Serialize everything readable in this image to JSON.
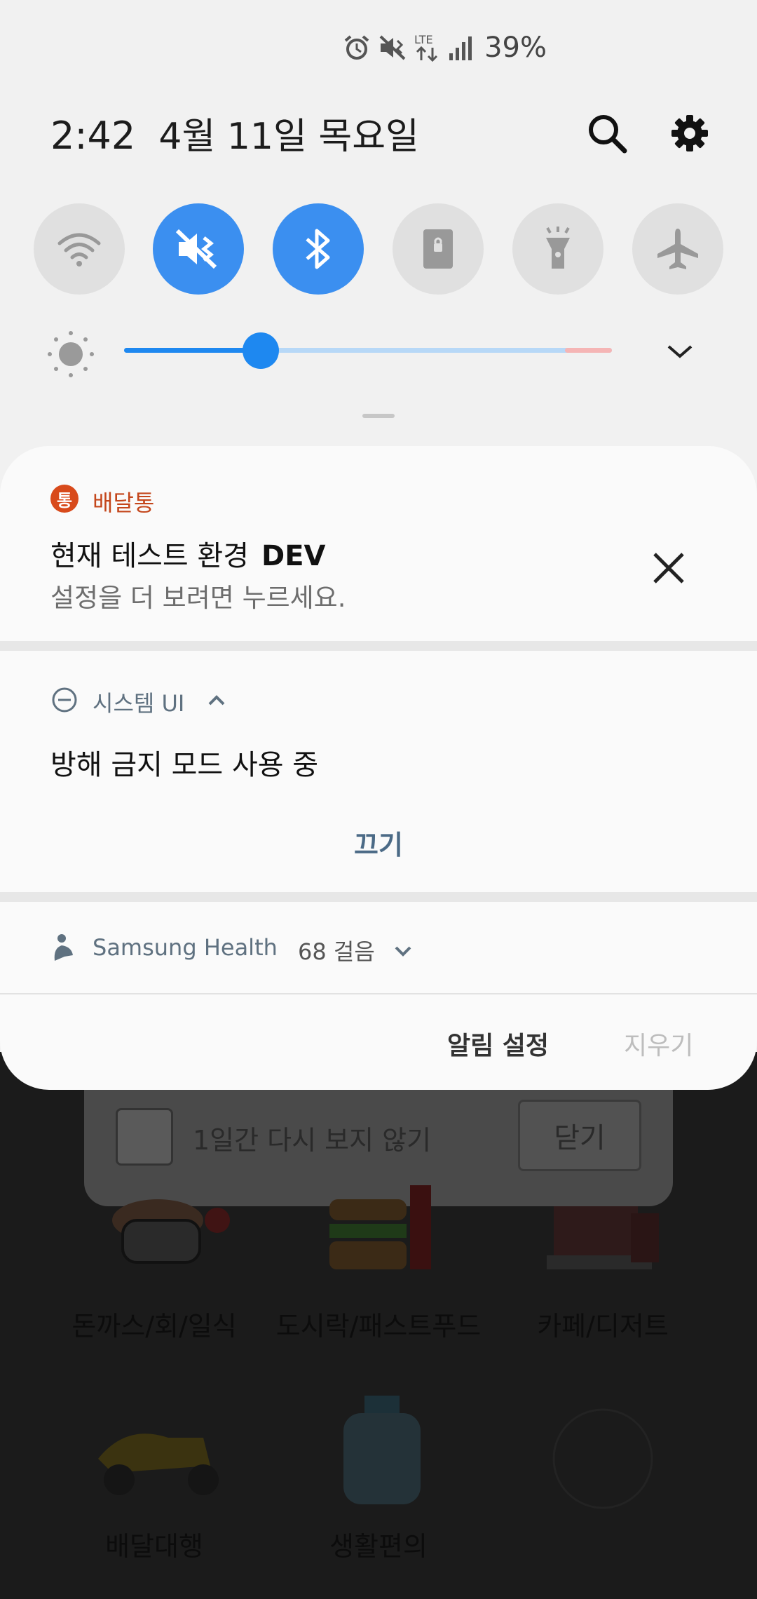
{
  "status_bar": {
    "icons": [
      "alarm-icon",
      "mute-vibrate-icon",
      "lte-icon",
      "signal-icon"
    ],
    "lte_label": "LTE",
    "battery": "39%"
  },
  "header": {
    "time": "2:42",
    "date": "4월 11일 목요일",
    "icons": [
      "search-icon",
      "gear-icon"
    ]
  },
  "quick_toggles": [
    {
      "name": "wifi",
      "icon": "wifi-icon",
      "on": false
    },
    {
      "name": "sound",
      "icon": "vibrate-icon",
      "on": true
    },
    {
      "name": "bluetooth",
      "icon": "bluetooth-icon",
      "on": true
    },
    {
      "name": "rotation-lock",
      "icon": "lock-icon",
      "on": false
    },
    {
      "name": "flashlight",
      "icon": "flashlight-icon",
      "on": false
    },
    {
      "name": "airplane",
      "icon": "airplane-icon",
      "on": false
    }
  ],
  "brightness": {
    "level": 0.28
  },
  "colors": {
    "accent": "#3b8ff0",
    "app_orange": "#d84a1b",
    "link": "#4b6a86"
  },
  "notifications": [
    {
      "app_badge": "통",
      "app": "배달통",
      "title": "현재 테스트 환경",
      "title_tag": "DEV",
      "subtitle": "설정을 더 보려면 누르세요."
    },
    {
      "app": "시스템 UI",
      "title": "방해 금지 모드 사용 중",
      "action": "끄기"
    },
    {
      "app": "Samsung Health",
      "detail": "68 걸음"
    }
  ],
  "footer": {
    "settings": "알림 설정",
    "clear": "지우기"
  },
  "background_app": {
    "popup": {
      "checkbox_label": "1일간 다시 보지 않기",
      "close": "닫기"
    },
    "categories": [
      "돈까스/회/일식",
      "도시락/패스트푸드",
      "카페/디저트",
      "배달대행",
      "생활편의"
    ]
  }
}
